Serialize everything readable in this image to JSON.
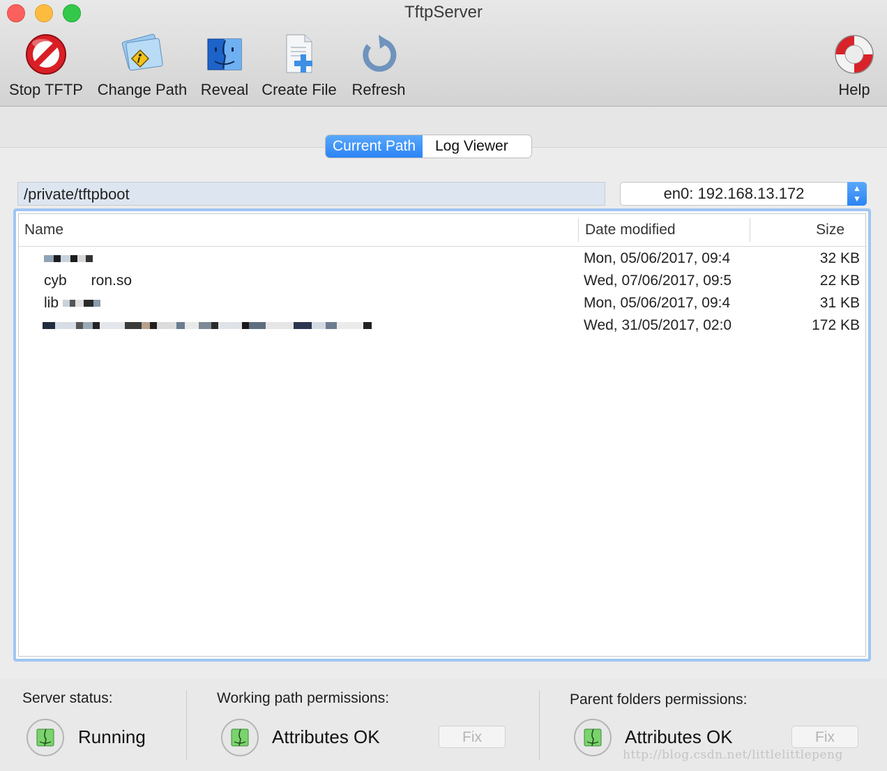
{
  "window": {
    "title": "TftpServer"
  },
  "toolbar": {
    "stop_label": "Stop TFTP",
    "change_path_label": "Change Path",
    "reveal_label": "Reveal",
    "create_file_label": "Create File",
    "refresh_label": "Refresh",
    "help_label": "Help"
  },
  "tabs": [
    {
      "label": "Current Path",
      "selected": true
    },
    {
      "label": "Log Viewer",
      "selected": false
    }
  ],
  "path": {
    "value": "/private/tftpboot"
  },
  "interface": {
    "selected": "en0: 192.168.13.172"
  },
  "table": {
    "columns": [
      "Name",
      "Date modified",
      "Size"
    ],
    "rows": [
      {
        "name": "",
        "date": "Mon, 05/06/2017, 09:4",
        "size": "32 KB"
      },
      {
        "name": "cyb      ron.so",
        "date": "Wed, 07/06/2017, 09:5",
        "size": "22 KB"
      },
      {
        "name": "lib",
        "date": "Mon, 05/06/2017, 09:4",
        "size": "31 KB"
      },
      {
        "name": "",
        "date": "Wed, 31/05/2017, 02:0",
        "size": "172 KB"
      }
    ]
  },
  "status": {
    "server_heading": "Server status:",
    "server_value": "Running",
    "working_heading": "Working path permissions:",
    "working_value": "Attributes OK",
    "working_fix": "Fix",
    "parent_heading": "Parent folders permissions:",
    "parent_value": "Attributes OK",
    "parent_fix": "Fix"
  },
  "watermark": "http://blog.csdn.net/littlelittlepeng",
  "colors": {
    "accent": "#2b84f5",
    "focus_ring": "#9fc6f3",
    "path_field": "#dde6f0"
  },
  "icons": [
    "stop-sign-icon",
    "change-path-icon",
    "finder-icon",
    "create-file-icon",
    "refresh-icon",
    "lifebuoy-icon",
    "finder-status-icon"
  ]
}
